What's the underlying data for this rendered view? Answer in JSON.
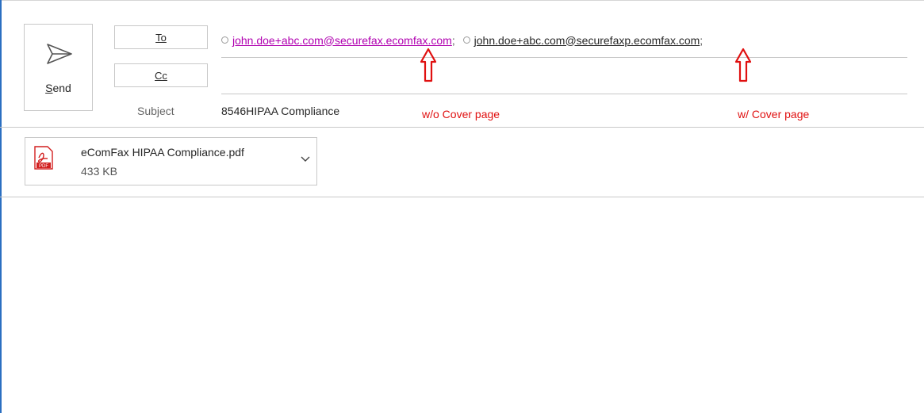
{
  "send": {
    "label": "Send",
    "icon": "send-icon"
  },
  "fields": {
    "to_label": "To",
    "cc_label": "Cc",
    "subject_label": "Subject",
    "subject_value": "8546HIPAA Compliance"
  },
  "recipients": [
    {
      "address": "john.doe+abc.com@securefax.ecomfax.com",
      "separator": ";",
      "color": "#b000b0"
    },
    {
      "address": "john.doe+abc.com@securefaxp.ecomfax.com",
      "separator": ";",
      "color": "#262626"
    }
  ],
  "annotations": {
    "first": "w/o Cover page",
    "second": "w/ Cover page",
    "color": "#e01010"
  },
  "attachment": {
    "name": "eComFax HIPAA Compliance.pdf",
    "size": "433 KB",
    "icon": "pdf-icon",
    "icon_text": "PDF"
  },
  "accent": "#2b6fc1"
}
